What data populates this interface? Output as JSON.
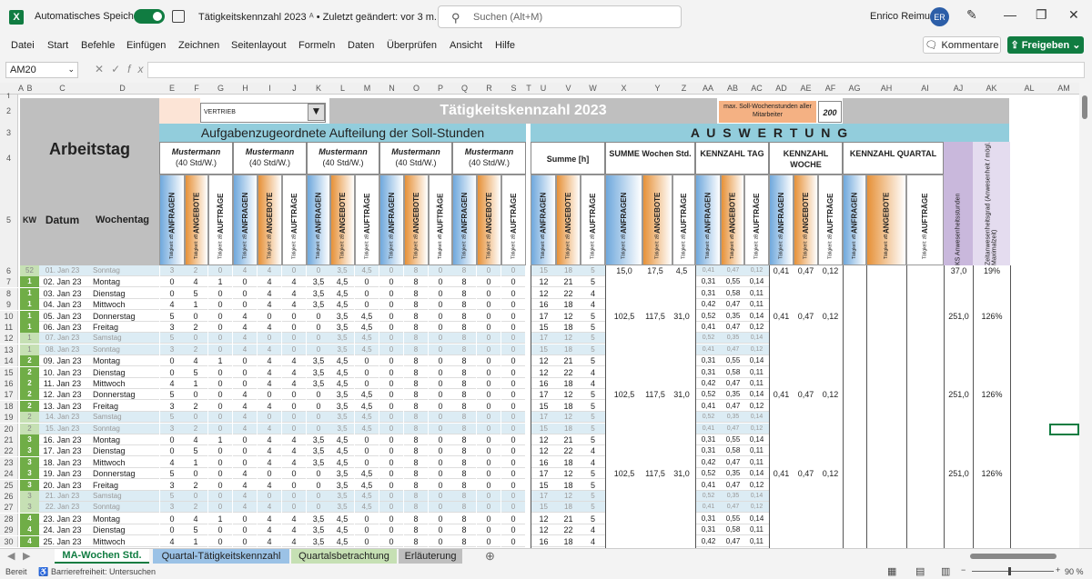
{
  "titlebar": {
    "app_icon": "X",
    "autosave_label": "Automatisches Speichern",
    "doc_title": "Tätigkeitskennzahl 2023",
    "last_changed": "• Zuletzt geändert: vor 3 m.",
    "search_placeholder": "Suchen (Alt+M)",
    "user_name": "Enrico Reimus",
    "user_initials": "ER"
  },
  "menu": [
    "Datei",
    "Start",
    "Befehle",
    "Einfügen",
    "Zeichnen",
    "Seitenlayout",
    "Formeln",
    "Daten",
    "Überprüfen",
    "Ansicht",
    "Hilfe"
  ],
  "buttons": {
    "comments": "Kommentare",
    "share": "Freigeben"
  },
  "formula": {
    "namebox": "AM20",
    "fx": "fx"
  },
  "columns": [
    "A",
    "B",
    "C",
    "D",
    "E",
    "F",
    "G",
    "H",
    "I",
    "J",
    "K",
    "L",
    "M",
    "N",
    "O",
    "P",
    "Q",
    "R",
    "S",
    "T",
    "U",
    "V",
    "W",
    "X",
    "Y",
    "Z",
    "AA",
    "AB",
    "AC",
    "AD",
    "AE",
    "AF",
    "AG",
    "AH",
    "AI",
    "AJ",
    "AK",
    "AL",
    "AM"
  ],
  "sheet": {
    "dept": "VERTRIEB",
    "main_title": "Tätigkeitskennzahl 2023",
    "max_hours_label": "max. Soll-Wochenstunden aller Mitarbeiter",
    "max_hours_value": "200",
    "arbeitstag": "Arbeitstag",
    "aufteilung": "Aufgabenzugeordnete Aufteilung der Soll-Stunden",
    "auswertung": "A U S W E R T U N G",
    "person_name": "Mustermann",
    "person_hours": "(40 Std/W.)",
    "summe_h": "Summe  [h]",
    "summe_wochen": "SUMME Wochen Std.",
    "kz_tag": "KENNZAHL TAG",
    "kz_woche": "KENNZAHL WOCHE",
    "kz_quartal": "KENNZAHL QUARTAL",
    "ks_anwesenheit": "KS Anwesenheitsstunden",
    "zeitanwesenheit": "Zeitanwesenheitsgrad (Anwesenheit / mögl. Maximalzeit)",
    "kw": "KW",
    "datum": "Datum",
    "wochentag": "Wochentag",
    "anfragen": "ANFRAGEN",
    "angebote": "ANGEBOTE",
    "auftraege": "AUFTRÄGE",
    "taetigkeit": "Tätigkeit: zB"
  },
  "rows": [
    {
      "r": "6",
      "kw": "52",
      "date": "01. Jan 23",
      "day": "Sonntag",
      "we": true,
      "v": [
        "3",
        "2",
        "0",
        "4",
        "4",
        "0",
        "0",
        "3,5",
        "4,5",
        "0",
        "8",
        "0",
        "8",
        "0",
        "0"
      ],
      "s": [
        "15",
        "18",
        "5"
      ],
      "sw": [
        "15,0",
        "17,5",
        "4,5"
      ],
      "t": [
        "0,41",
        "0,47",
        "0,12"
      ],
      "w": [
        "0,41",
        "0,47",
        "0,12"
      ],
      "ks": "37,0",
      "z": "19%"
    },
    {
      "r": "7",
      "kw": "1",
      "date": "02. Jan 23",
      "day": "Montag",
      "v": [
        "0",
        "4",
        "1",
        "0",
        "4",
        "4",
        "3,5",
        "4,5",
        "0",
        "0",
        "8",
        "0",
        "8",
        "0",
        "0"
      ],
      "s": [
        "12",
        "21",
        "5"
      ],
      "t": [
        "0,31",
        "0,55",
        "0,14"
      ]
    },
    {
      "r": "8",
      "kw": "1",
      "date": "03. Jan 23",
      "day": "Dienstag",
      "v": [
        "0",
        "5",
        "0",
        "0",
        "4",
        "4",
        "3,5",
        "4,5",
        "0",
        "0",
        "8",
        "0",
        "8",
        "0",
        "0"
      ],
      "s": [
        "12",
        "22",
        "4"
      ],
      "t": [
        "0,31",
        "0,58",
        "0,11"
      ]
    },
    {
      "r": "9",
      "kw": "1",
      "date": "04. Jan 23",
      "day": "Mittwoch",
      "v": [
        "4",
        "1",
        "0",
        "0",
        "4",
        "4",
        "3,5",
        "4,5",
        "0",
        "0",
        "8",
        "0",
        "8",
        "0",
        "0"
      ],
      "s": [
        "16",
        "18",
        "4"
      ],
      "t": [
        "0,42",
        "0,47",
        "0,11"
      ]
    },
    {
      "r": "10",
      "kw": "1",
      "date": "05. Jan 23",
      "day": "Donnerstag",
      "v": [
        "5",
        "0",
        "0",
        "4",
        "0",
        "0",
        "0",
        "3,5",
        "4,5",
        "0",
        "8",
        "0",
        "8",
        "0",
        "0"
      ],
      "s": [
        "17",
        "12",
        "5"
      ],
      "t": [
        "0,52",
        "0,35",
        "0,14"
      ],
      "sw": [
        "102,5",
        "117,5",
        "31,0"
      ],
      "w": [
        "0,41",
        "0,47",
        "0,12"
      ],
      "ks": "251,0",
      "z": "126%"
    },
    {
      "r": "11",
      "kw": "1",
      "date": "06. Jan 23",
      "day": "Freitag",
      "v": [
        "3",
        "2",
        "0",
        "4",
        "4",
        "0",
        "0",
        "3,5",
        "4,5",
        "0",
        "8",
        "0",
        "8",
        "0",
        "0"
      ],
      "s": [
        "15",
        "18",
        "5"
      ],
      "t": [
        "0,41",
        "0,47",
        "0,12"
      ]
    },
    {
      "r": "12",
      "kw": "1",
      "date": "07. Jan 23",
      "day": "Samstag",
      "we": true,
      "v": [
        "5",
        "0",
        "0",
        "4",
        "0",
        "0",
        "0",
        "3,5",
        "4,5",
        "0",
        "8",
        "0",
        "8",
        "0",
        "0"
      ],
      "s": [
        "17",
        "12",
        "5"
      ],
      "t": [
        "0,52",
        "0,35",
        "0,14"
      ]
    },
    {
      "r": "13",
      "kw": "1",
      "date": "08. Jan 23",
      "day": "Sonntag",
      "we": true,
      "v": [
        "3",
        "2",
        "0",
        "4",
        "4",
        "0",
        "0",
        "3,5",
        "4,5",
        "0",
        "8",
        "0",
        "8",
        "0",
        "0"
      ],
      "s": [
        "15",
        "18",
        "5"
      ],
      "t": [
        "0,41",
        "0,47",
        "0,12"
      ]
    },
    {
      "r": "14",
      "kw": "2",
      "date": "09. Jan 23",
      "day": "Montag",
      "v": [
        "0",
        "4",
        "1",
        "0",
        "4",
        "4",
        "3,5",
        "4,5",
        "0",
        "0",
        "8",
        "0",
        "8",
        "0",
        "0"
      ],
      "s": [
        "12",
        "21",
        "5"
      ],
      "t": [
        "0,31",
        "0,55",
        "0,14"
      ]
    },
    {
      "r": "15",
      "kw": "2",
      "date": "10. Jan 23",
      "day": "Dienstag",
      "v": [
        "0",
        "5",
        "0",
        "0",
        "4",
        "4",
        "3,5",
        "4,5",
        "0",
        "0",
        "8",
        "0",
        "8",
        "0",
        "0"
      ],
      "s": [
        "12",
        "22",
        "4"
      ],
      "t": [
        "0,31",
        "0,58",
        "0,11"
      ]
    },
    {
      "r": "16",
      "kw": "2",
      "date": "11. Jan 23",
      "day": "Mittwoch",
      "v": [
        "4",
        "1",
        "0",
        "0",
        "4",
        "4",
        "3,5",
        "4,5",
        "0",
        "0",
        "8",
        "0",
        "8",
        "0",
        "0"
      ],
      "s": [
        "16",
        "18",
        "4"
      ],
      "t": [
        "0,42",
        "0,47",
        "0,11"
      ]
    },
    {
      "r": "17",
      "kw": "2",
      "date": "12. Jan 23",
      "day": "Donnerstag",
      "v": [
        "5",
        "0",
        "0",
        "4",
        "0",
        "0",
        "0",
        "3,5",
        "4,5",
        "0",
        "8",
        "0",
        "8",
        "0",
        "0"
      ],
      "s": [
        "17",
        "12",
        "5"
      ],
      "t": [
        "0,52",
        "0,35",
        "0,14"
      ],
      "sw": [
        "102,5",
        "117,5",
        "31,0"
      ],
      "w": [
        "0,41",
        "0,47",
        "0,12"
      ],
      "ks": "251,0",
      "z": "126%"
    },
    {
      "r": "18",
      "kw": "2",
      "date": "13. Jan 23",
      "day": "Freitag",
      "v": [
        "3",
        "2",
        "0",
        "4",
        "4",
        "0",
        "0",
        "3,5",
        "4,5",
        "0",
        "8",
        "0",
        "8",
        "0",
        "0"
      ],
      "s": [
        "15",
        "18",
        "5"
      ],
      "t": [
        "0,41",
        "0,47",
        "0,12"
      ]
    },
    {
      "r": "19",
      "kw": "2",
      "date": "14. Jan 23",
      "day": "Samstag",
      "we": true,
      "v": [
        "5",
        "0",
        "0",
        "4",
        "0",
        "0",
        "0",
        "3,5",
        "4,5",
        "0",
        "8",
        "0",
        "8",
        "0",
        "0"
      ],
      "s": [
        "17",
        "12",
        "5"
      ],
      "t": [
        "0,52",
        "0,35",
        "0,14"
      ]
    },
    {
      "r": "20",
      "kw": "2",
      "date": "15. Jan 23",
      "day": "Sonntag",
      "we": true,
      "v": [
        "3",
        "2",
        "0",
        "4",
        "4",
        "0",
        "0",
        "3,5",
        "4,5",
        "0",
        "8",
        "0",
        "8",
        "0",
        "0"
      ],
      "s": [
        "15",
        "18",
        "5"
      ],
      "t": [
        "0,41",
        "0,47",
        "0,12"
      ]
    },
    {
      "r": "21",
      "kw": "3",
      "date": "16. Jan 23",
      "day": "Montag",
      "v": [
        "0",
        "4",
        "1",
        "0",
        "4",
        "4",
        "3,5",
        "4,5",
        "0",
        "0",
        "8",
        "0",
        "8",
        "0",
        "0"
      ],
      "s": [
        "12",
        "21",
        "5"
      ],
      "t": [
        "0,31",
        "0,55",
        "0,14"
      ]
    },
    {
      "r": "22",
      "kw": "3",
      "date": "17. Jan 23",
      "day": "Dienstag",
      "v": [
        "0",
        "5",
        "0",
        "0",
        "4",
        "4",
        "3,5",
        "4,5",
        "0",
        "0",
        "8",
        "0",
        "8",
        "0",
        "0"
      ],
      "s": [
        "12",
        "22",
        "4"
      ],
      "t": [
        "0,31",
        "0,58",
        "0,11"
      ]
    },
    {
      "r": "23",
      "kw": "3",
      "date": "18. Jan 23",
      "day": "Mittwoch",
      "v": [
        "4",
        "1",
        "0",
        "0",
        "4",
        "4",
        "3,5",
        "4,5",
        "0",
        "0",
        "8",
        "0",
        "8",
        "0",
        "0"
      ],
      "s": [
        "16",
        "18",
        "4"
      ],
      "t": [
        "0,42",
        "0,47",
        "0,11"
      ]
    },
    {
      "r": "24",
      "kw": "3",
      "date": "19. Jan 23",
      "day": "Donnerstag",
      "v": [
        "5",
        "0",
        "0",
        "4",
        "0",
        "0",
        "0",
        "3,5",
        "4,5",
        "0",
        "8",
        "0",
        "8",
        "0",
        "0"
      ],
      "s": [
        "17",
        "12",
        "5"
      ],
      "t": [
        "0,52",
        "0,35",
        "0,14"
      ],
      "sw": [
        "102,5",
        "117,5",
        "31,0"
      ],
      "w": [
        "0,41",
        "0,47",
        "0,12"
      ],
      "ks": "251,0",
      "z": "126%"
    },
    {
      "r": "25",
      "kw": "3",
      "date": "20. Jan 23",
      "day": "Freitag",
      "v": [
        "3",
        "2",
        "0",
        "4",
        "4",
        "0",
        "0",
        "3,5",
        "4,5",
        "0",
        "8",
        "0",
        "8",
        "0",
        "0"
      ],
      "s": [
        "15",
        "18",
        "5"
      ],
      "t": [
        "0,41",
        "0,47",
        "0,12"
      ]
    },
    {
      "r": "26",
      "kw": "3",
      "date": "21. Jan 23",
      "day": "Samstag",
      "we": true,
      "v": [
        "5",
        "0",
        "0",
        "4",
        "0",
        "0",
        "0",
        "3,5",
        "4,5",
        "0",
        "8",
        "0",
        "8",
        "0",
        "0"
      ],
      "s": [
        "17",
        "12",
        "5"
      ],
      "t": [
        "0,52",
        "0,35",
        "0,14"
      ]
    },
    {
      "r": "27",
      "kw": "3",
      "date": "22. Jan 23",
      "day": "Sonntag",
      "we": true,
      "v": [
        "3",
        "2",
        "0",
        "4",
        "4",
        "0",
        "0",
        "3,5",
        "4,5",
        "0",
        "8",
        "0",
        "8",
        "0",
        "0"
      ],
      "s": [
        "15",
        "18",
        "5"
      ],
      "t": [
        "0,41",
        "0,47",
        "0,12"
      ]
    },
    {
      "r": "28",
      "kw": "4",
      "date": "23. Jan 23",
      "day": "Montag",
      "v": [
        "0",
        "4",
        "1",
        "0",
        "4",
        "4",
        "3,5",
        "4,5",
        "0",
        "0",
        "8",
        "0",
        "8",
        "0",
        "0"
      ],
      "s": [
        "12",
        "21",
        "5"
      ],
      "t": [
        "0,31",
        "0,55",
        "0,14"
      ]
    },
    {
      "r": "29",
      "kw": "4",
      "date": "24. Jan 23",
      "day": "Dienstag",
      "v": [
        "0",
        "5",
        "0",
        "0",
        "4",
        "4",
        "3,5",
        "4,5",
        "0",
        "0",
        "8",
        "0",
        "8",
        "0",
        "0"
      ],
      "s": [
        "12",
        "22",
        "4"
      ],
      "t": [
        "0,31",
        "0,58",
        "0,11"
      ]
    },
    {
      "r": "30",
      "kw": "4",
      "date": "25. Jan 23",
      "day": "Mittwoch",
      "v": [
        "4",
        "1",
        "0",
        "0",
        "4",
        "4",
        "3,5",
        "4,5",
        "0",
        "0",
        "8",
        "0",
        "8",
        "0",
        "0"
      ],
      "s": [
        "16",
        "18",
        "4"
      ],
      "t": [
        "0,42",
        "0,47",
        "0,11"
      ]
    }
  ],
  "tabs": [
    {
      "label": "MA-Wochen Std.",
      "color": "#a9d08e",
      "active": true
    },
    {
      "label": "Quartal-Tätigkeitskennzahl",
      "color": "#9bc2e6"
    },
    {
      "label": "Quartalsbetrachtung",
      "color": "#c6e0b4"
    },
    {
      "label": "Erläuterung",
      "color": "#bfbfbf"
    }
  ],
  "status": {
    "ready": "Bereit",
    "accessibility": "Barrierefreiheit: Untersuchen",
    "zoom": "90 %"
  }
}
